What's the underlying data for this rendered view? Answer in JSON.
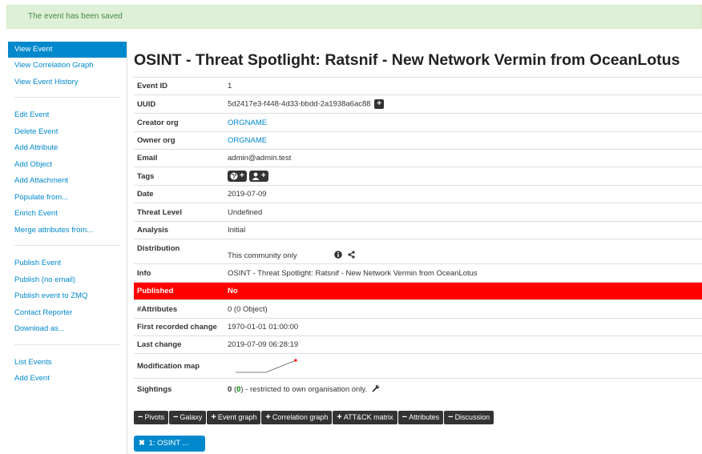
{
  "alert": "The event has been saved",
  "sidebar": {
    "group1": [
      "View Event",
      "View Correlation Graph",
      "View Event History"
    ],
    "group2": [
      "Edit Event",
      "Delete Event",
      "Add Attribute",
      "Add Object",
      "Add Attachment",
      "Populate from...",
      "Enrich Event",
      "Merge attributes from..."
    ],
    "group3": [
      "Publish Event",
      "Publish (no email)",
      "Publish event to ZMQ",
      "Contact Reporter",
      "Download as..."
    ],
    "group4": [
      "List Events",
      "Add Event"
    ]
  },
  "event": {
    "title": "OSINT - Threat Spotlight: Ratsnif - New Network Vermin from OceanLotus",
    "labels": {
      "id": "Event ID",
      "uuid": "UUID",
      "creator": "Creator org",
      "owner": "Owner org",
      "email": "Email",
      "tags": "Tags",
      "date": "Date",
      "threat": "Threat Level",
      "analysis": "Analysis",
      "distribution": "Distribution",
      "info": "Info",
      "published": "Published",
      "attributes": "#Attributes",
      "first": "First recorded change",
      "last": "Last change",
      "modmap": "Modification map",
      "sightings": "Sightings"
    },
    "id": "1",
    "uuid": "5d2417e3-f448-4d33-bbdd-2a1938a6ac88",
    "creator_org": "ORGNAME",
    "owner_org": "ORGNAME",
    "email": "admin@admin.test",
    "date": "2019-07-09",
    "threat_level": "Undefined",
    "analysis": "Initial",
    "distribution": "This community only",
    "info": "OSINT - Threat Spotlight: Ratsnif - New Network Vermin from OceanLotus",
    "published": "No",
    "attributes": "0 (0 Object)",
    "first_change": "1970-01-01 01:00:00",
    "last_change": "2019-07-09 06:28:19",
    "sightings_count": "0",
    "sightings_paren_count": "0",
    "sightings_text": " - restricted to own organisation only.",
    "published_color": "#ff0000"
  },
  "toolbar": [
    {
      "sign": "−",
      "label": "Pivots"
    },
    {
      "sign": "−",
      "label": "Galaxy"
    },
    {
      "sign": "+",
      "label": "Event graph"
    },
    {
      "sign": "+",
      "label": "Correlation graph"
    },
    {
      "sign": "+",
      "label": "ATT&CK matrix"
    },
    {
      "sign": "−",
      "label": "Attributes"
    },
    {
      "sign": "−",
      "label": "Discussion"
    }
  ],
  "pivot": "1: OSINT ..."
}
